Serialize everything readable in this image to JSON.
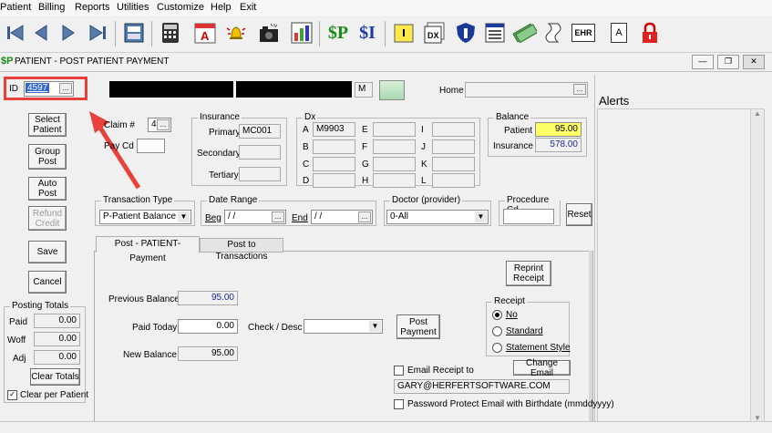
{
  "menu": [
    "Patient",
    "Billing",
    "Reports",
    "Utilities",
    "Customize",
    "Help",
    "Exit"
  ],
  "toolbar": {
    "icons": [
      "first-icon",
      "prev-icon",
      "next-icon",
      "last-icon",
      "print-icon",
      "calculator-icon",
      "calendar-icon",
      "alarm-icon",
      "camera-icon",
      "chart-icon",
      "payment-p-icon",
      "payment-i-icon",
      "folder-icon",
      "dx-icon",
      "shield-icon",
      "form-icon",
      "money-icon",
      "paper-icon",
      "ehr-icon",
      "a-doc-icon",
      "lock-icon"
    ],
    "dx_label": "DX",
    "ehr_label": "EHR",
    "a_label": "A",
    "p_label": "$P",
    "i_label": "$I"
  },
  "window": {
    "title": "PATIENT - POST PATIENT PAYMENT",
    "icon_text": "$P"
  },
  "header": {
    "id_label": "ID",
    "id_value": "4597",
    "sex_value": "M",
    "home_label": "Home",
    "home_value": ""
  },
  "alerts": {
    "title": "Alerts"
  },
  "left_buttons": {
    "select_patient": "Select Patient",
    "group_post": "Group Post",
    "auto_post": "Auto Post",
    "refund_credit": "Refund Credit",
    "save": "Save",
    "cancel": "Cancel"
  },
  "claim": {
    "claim_label": "Claim #",
    "claim_value": "4",
    "pay_cd_label": "Pay Cd",
    "pay_cd_value": ""
  },
  "insurance": {
    "title": "Insurance",
    "primary_label": "Primary",
    "primary_value": "MC001",
    "secondary_label": "Secondary",
    "secondary_value": "",
    "tertiary_label": "Tertiary",
    "tertiary_value": ""
  },
  "dx": {
    "title": "Dx",
    "letters": [
      "A",
      "B",
      "C",
      "D",
      "E",
      "F",
      "G",
      "H",
      "I",
      "J",
      "K",
      "L"
    ],
    "values": [
      "M9903",
      "",
      "",
      "",
      "",
      "",
      "",
      "",
      "",
      "",
      "",
      ""
    ]
  },
  "balance": {
    "title": "Balance",
    "patient_label": "Patient",
    "patient_value": "95.00",
    "insurance_label": "Insurance",
    "insurance_value": "578.00",
    "patient_color": "#ffff66"
  },
  "filters": {
    "transaction_type_label": "Transaction Type",
    "transaction_type_value": "P-Patient Balance",
    "date_range_label": "Date Range",
    "beg_label": "Beg",
    "beg_value": "/ /",
    "end_label": "End",
    "end_value": "/ /",
    "doctor_label": "Doctor (provider)",
    "doctor_value": "0-All",
    "procedure_label": "Procedure Cd",
    "procedure_value": "",
    "reset_label": "Reset"
  },
  "tabs": [
    "Post - PATIENT- Payment",
    "Post to Transactions"
  ],
  "payment": {
    "reprint_label": "Reprint Receipt",
    "previous_balance_label": "Previous Balance",
    "previous_balance_value": "95.00",
    "paid_today_label": "Paid Today",
    "paid_today_value": "0.00",
    "check_desc_label": "Check / Desc",
    "check_desc_value": "",
    "post_payment_label": "Post Payment",
    "new_balance_label": "New Balance",
    "new_balance_value": "95.00",
    "receipt_title": "Receipt",
    "receipt_options": [
      "No",
      "Standard",
      "Statement Style"
    ],
    "receipt_selected": "No",
    "email_receipt_label": "Email Receipt to",
    "change_email_label": "Change Email",
    "email_value": "GARY@HERFERTSOFTWARE.COM",
    "password_protect_label": "Password Protect Email with Birthdate (mmddyyyy)"
  },
  "posting_totals": {
    "title": "Posting Totals",
    "paid_label": "Paid",
    "paid_value": "0.00",
    "woff_label": "Woff",
    "woff_value": "0.00",
    "adj_label": "Adj",
    "adj_value": "0.00",
    "clear_totals_label": "Clear Totals",
    "clear_per_patient_label": "Clear per Patient",
    "clear_per_patient_checked": true
  },
  "colors": {
    "highlight_red": "#e8403a",
    "selection_blue": "#3366cc"
  }
}
